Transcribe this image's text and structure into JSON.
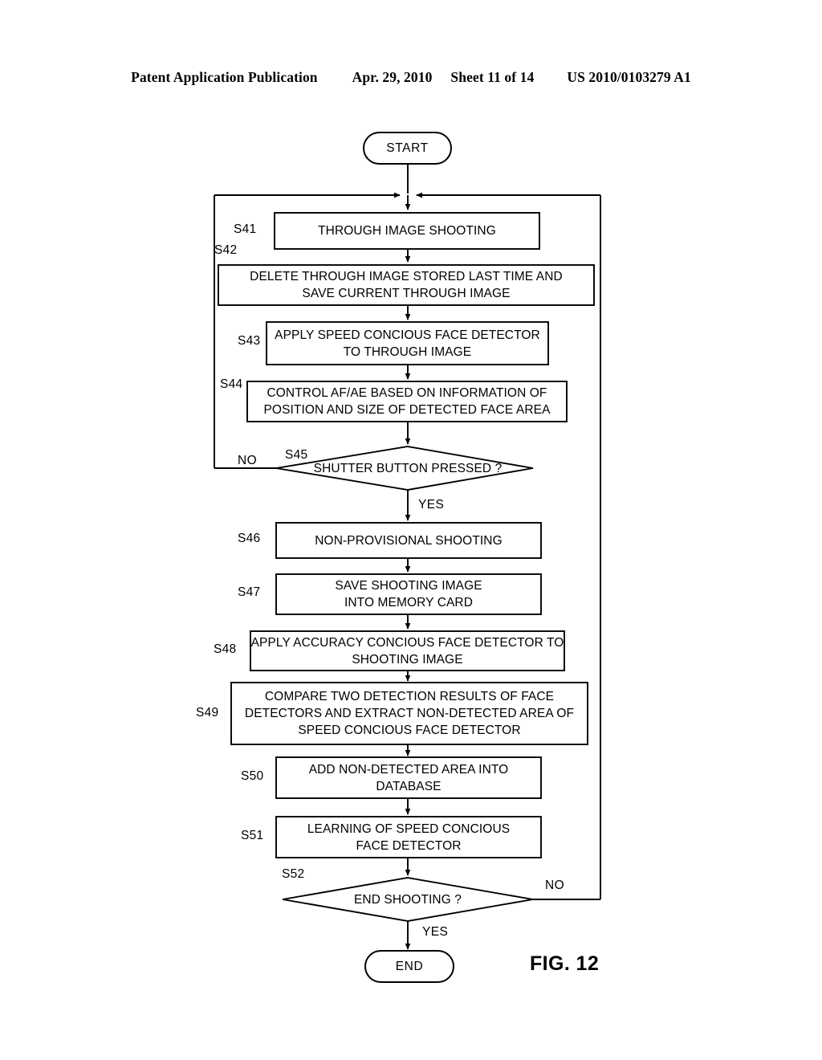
{
  "header": {
    "publication": "Patent Application Publication",
    "date": "Apr. 29, 2010",
    "sheet": "Sheet 11 of 14",
    "patent_number": "US 2010/0103279 A1"
  },
  "figure": {
    "label": "FIG. 12",
    "start_label": "START",
    "end_label": "END"
  },
  "nodes": {
    "s41": {
      "id": "S41",
      "text": "THROUGH IMAGE SHOOTING"
    },
    "s42": {
      "id": "S42",
      "line1": "DELETE THROUGH IMAGE STORED LAST TIME AND",
      "line2": "SAVE CURRENT THROUGH IMAGE"
    },
    "s43": {
      "id": "S43",
      "line1": "APPLY SPEED CONCIOUS FACE DETECTOR",
      "line2": "TO THROUGH IMAGE"
    },
    "s44": {
      "id": "S44",
      "line1": "CONTROL AF/AE BASED ON INFORMATION OF",
      "line2": "POSITION AND SIZE OF DETECTED FACE AREA"
    },
    "s45": {
      "id": "S45",
      "text": "SHUTTER BUTTON PRESSED ?",
      "yes": "YES",
      "no": "NO"
    },
    "s46": {
      "id": "S46",
      "text": "NON-PROVISIONAL SHOOTING"
    },
    "s47": {
      "id": "S47",
      "line1": "SAVE SHOOTING IMAGE",
      "line2": "INTO MEMORY CARD"
    },
    "s48": {
      "id": "S48",
      "line1": "APPLY ACCURACY CONCIOUS FACE DETECTOR TO",
      "line2": "SHOOTING IMAGE"
    },
    "s49": {
      "id": "S49",
      "line1": "COMPARE TWO DETECTION RESULTS OF FACE",
      "line2": "DETECTORS AND EXTRACT NON-DETECTED AREA OF",
      "line3": "SPEED CONCIOUS FACE DETECTOR"
    },
    "s50": {
      "id": "S50",
      "line1": "ADD NON-DETECTED AREA INTO",
      "line2": "DATABASE"
    },
    "s51": {
      "id": "S51",
      "line1": "LEARNING OF SPEED CONCIOUS",
      "line2": "FACE DETECTOR"
    },
    "s52": {
      "id": "S52",
      "text": "END SHOOTING ?",
      "yes": "YES",
      "no": "NO"
    }
  },
  "chart_data": {
    "type": "diagram",
    "diagram_kind": "flowchart",
    "title": "FIG. 12",
    "stroke_color": "#000000",
    "fill_color": "#ffffff",
    "steps": [
      {
        "id": "START",
        "shape": "terminal",
        "text": "START"
      },
      {
        "id": "S41",
        "shape": "process",
        "text": "THROUGH IMAGE SHOOTING"
      },
      {
        "id": "S42",
        "shape": "process",
        "text": "DELETE THROUGH IMAGE STORED LAST TIME AND SAVE CURRENT THROUGH IMAGE"
      },
      {
        "id": "S43",
        "shape": "process",
        "text": "APPLY SPEED CONCIOUS FACE DETECTOR TO THROUGH IMAGE"
      },
      {
        "id": "S44",
        "shape": "process",
        "text": "CONTROL AF/AE BASED ON INFORMATION OF POSITION AND SIZE OF DETECTED FACE AREA"
      },
      {
        "id": "S45",
        "shape": "decision",
        "text": "SHUTTER BUTTON PRESSED ?"
      },
      {
        "id": "S46",
        "shape": "process",
        "text": "NON-PROVISIONAL SHOOTING"
      },
      {
        "id": "S47",
        "shape": "process",
        "text": "SAVE SHOOTING IMAGE INTO MEMORY CARD"
      },
      {
        "id": "S48",
        "shape": "process",
        "text": "APPLY ACCURACY CONCIOUS FACE DETECTOR TO SHOOTING IMAGE"
      },
      {
        "id": "S49",
        "shape": "process",
        "text": "COMPARE TWO DETECTION RESULTS OF FACE DETECTORS AND EXTRACT NON-DETECTED AREA OF SPEED CONCIOUS FACE DETECTOR"
      },
      {
        "id": "S50",
        "shape": "process",
        "text": "ADD NON-DETECTED AREA INTO DATABASE"
      },
      {
        "id": "S51",
        "shape": "process",
        "text": "LEARNING OF SPEED CONCIOUS FACE DETECTOR"
      },
      {
        "id": "S52",
        "shape": "decision",
        "text": "END SHOOTING ?"
      },
      {
        "id": "END",
        "shape": "terminal",
        "text": "END"
      }
    ],
    "edges": [
      {
        "from": "START",
        "to": "S41",
        "label": ""
      },
      {
        "from": "S41",
        "to": "S42",
        "label": ""
      },
      {
        "from": "S42",
        "to": "S43",
        "label": ""
      },
      {
        "from": "S43",
        "to": "S44",
        "label": ""
      },
      {
        "from": "S44",
        "to": "S45",
        "label": ""
      },
      {
        "from": "S45",
        "to": "S46",
        "label": "YES"
      },
      {
        "from": "S45",
        "to": "S41",
        "label": "NO"
      },
      {
        "from": "S46",
        "to": "S47",
        "label": ""
      },
      {
        "from": "S47",
        "to": "S48",
        "label": ""
      },
      {
        "from": "S48",
        "to": "S49",
        "label": ""
      },
      {
        "from": "S49",
        "to": "S50",
        "label": ""
      },
      {
        "from": "S50",
        "to": "S51",
        "label": ""
      },
      {
        "from": "S51",
        "to": "S52",
        "label": ""
      },
      {
        "from": "S52",
        "to": "END",
        "label": "YES"
      },
      {
        "from": "S52",
        "to": "S41",
        "label": "NO"
      }
    ]
  }
}
